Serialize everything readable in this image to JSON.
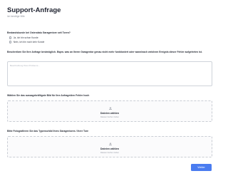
{
  "header": {
    "title": "Support-Anfrage",
    "subtitle": "Ich benötige Hilfe"
  },
  "questions": {
    "customer": {
      "label": "Bestandskunde bei Ostendatu Garagentore seit Toren?",
      "options": [
        "Ja, ich bin schon Kunde",
        "Nein, ich bin noch kein Kunde"
      ]
    },
    "description": {
      "label": "Beschreiben Sie Ihre Anfrage bestmöglich. Bspw. was an Ihrem Garagentor genau nicht mehr funktioniert oder wann/nach welchem Ereignis dieser Fehler aufgetreten ist.",
      "placeholder": "Beschreibung Ihres Problems..."
    },
    "image_upload": {
      "label": "Wählen Sie das aussagekräftigste Bild für Ihre Anfrage/den Fehler hoch",
      "button": "Dateien wählen",
      "hint": "Dateien hierher ziehen"
    },
    "type_plate": {
      "label": "Bitte Fotografieren Sie das Typenschild Ihres Garagentores / Ihrer Tore",
      "button": "Dateien wählen",
      "hint": "Dateien hierher ziehen"
    }
  },
  "footer": {
    "next_label": "Weiter"
  },
  "colors": {
    "accent": "#4a7cf0",
    "title": "#1f2330",
    "muted": "#8b8f99",
    "border": "#cfd3da"
  },
  "icons": {
    "upload": "cloud-upload-icon"
  }
}
